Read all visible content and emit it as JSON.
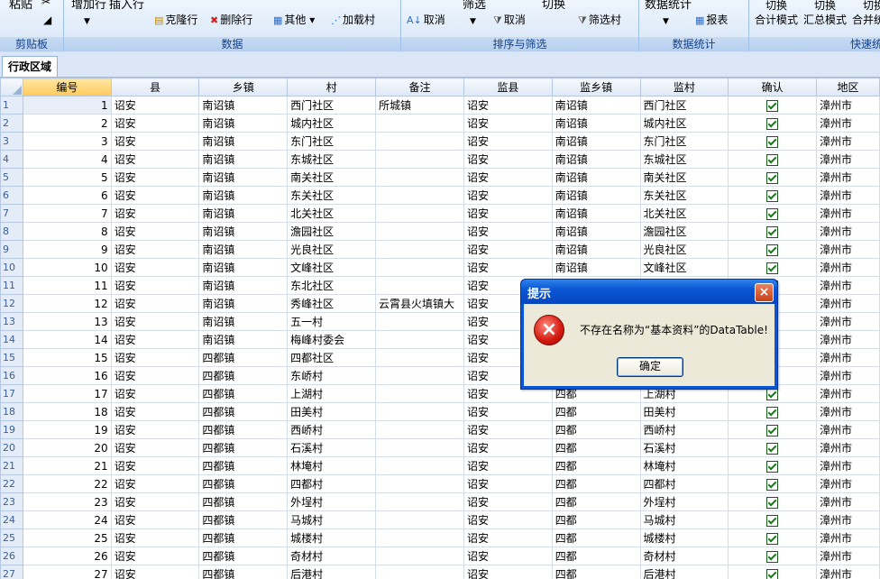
{
  "ribbon": {
    "groups": [
      {
        "title": "剪贴板",
        "buttons": [
          "粘贴"
        ]
      },
      {
        "title": "数据",
        "buttons": [
          "增加行",
          "插入行",
          "克隆行",
          "删除行",
          "其他",
          "加载村"
        ]
      },
      {
        "title": "排序与筛选",
        "buttons": [
          "取消",
          "筛选",
          "取消",
          "切换",
          "筛选村"
        ]
      },
      {
        "title": "数据统计",
        "buttons": [
          "数据统计",
          "报表"
        ]
      },
      {
        "title": "快速统",
        "buttons": [
          "切换",
          "合计模式",
          "切换",
          "汇总模式",
          "切换",
          "合并统"
        ]
      }
    ]
  },
  "tab": {
    "label": "行政区域"
  },
  "grid": {
    "columns": [
      "编号",
      "县",
      "乡镇",
      "村",
      "备注",
      "监县",
      "监乡镇",
      "监村",
      "确认",
      "地区"
    ],
    "rows": [
      [
        "1",
        "1",
        "诏安",
        "南诏镇",
        "西门社区",
        "所城镇",
        "诏安",
        "南诏镇",
        "西门社区",
        "true",
        "漳州市"
      ],
      [
        "2",
        "2",
        "诏安",
        "南诏镇",
        "城内社区",
        "",
        "诏安",
        "南诏镇",
        "城内社区",
        "true",
        "漳州市"
      ],
      [
        "3",
        "3",
        "诏安",
        "南诏镇",
        "东门社区",
        "",
        "诏安",
        "南诏镇",
        "东门社区",
        "true",
        "漳州市"
      ],
      [
        "4",
        "4",
        "诏安",
        "南诏镇",
        "东城社区",
        "",
        "诏安",
        "南诏镇",
        "东城社区",
        "true",
        "漳州市"
      ],
      [
        "5",
        "5",
        "诏安",
        "南诏镇",
        "南关社区",
        "",
        "诏安",
        "南诏镇",
        "南关社区",
        "true",
        "漳州市"
      ],
      [
        "6",
        "6",
        "诏安",
        "南诏镇",
        "东关社区",
        "",
        "诏安",
        "南诏镇",
        "东关社区",
        "true",
        "漳州市"
      ],
      [
        "7",
        "7",
        "诏安",
        "南诏镇",
        "北关社区",
        "",
        "诏安",
        "南诏镇",
        "北关社区",
        "true",
        "漳州市"
      ],
      [
        "8",
        "8",
        "诏安",
        "南诏镇",
        "澹园社区",
        "",
        "诏安",
        "南诏镇",
        "澹园社区",
        "true",
        "漳州市"
      ],
      [
        "9",
        "9",
        "诏安",
        "南诏镇",
        "光良社区",
        "",
        "诏安",
        "南诏镇",
        "光良社区",
        "true",
        "漳州市"
      ],
      [
        "10",
        "10",
        "诏安",
        "南诏镇",
        "文峰社区",
        "",
        "诏安",
        "南诏镇",
        "文峰社区",
        "true",
        "漳州市"
      ],
      [
        "11",
        "11",
        "诏安",
        "南诏镇",
        "东北社区",
        "",
        "诏安",
        "",
        "",
        "true",
        "漳州市"
      ],
      [
        "12",
        "12",
        "诏安",
        "南诏镇",
        "秀峰社区",
        "云霄县火填镇大",
        "诏安",
        "",
        "",
        "true",
        "漳州市"
      ],
      [
        "13",
        "13",
        "诏安",
        "南诏镇",
        "五一村",
        "",
        "诏安",
        "",
        "",
        "true",
        "漳州市"
      ],
      [
        "14",
        "14",
        "诏安",
        "南诏镇",
        "梅峰村委会",
        "",
        "诏安",
        "",
        "",
        "true",
        "漳州市"
      ],
      [
        "15",
        "15",
        "诏安",
        "四都镇",
        "四都社区",
        "",
        "诏安",
        "",
        "",
        "true",
        "漳州市"
      ],
      [
        "16",
        "16",
        "诏安",
        "四都镇",
        "东峤村",
        "",
        "诏安",
        "",
        "",
        "true",
        "漳州市"
      ],
      [
        "17",
        "17",
        "诏安",
        "四都镇",
        "上湖村",
        "",
        "诏安",
        "四都",
        "上湖村",
        "true",
        "漳州市"
      ],
      [
        "18",
        "18",
        "诏安",
        "四都镇",
        "田美村",
        "",
        "诏安",
        "四都",
        "田美村",
        "true",
        "漳州市"
      ],
      [
        "19",
        "19",
        "诏安",
        "四都镇",
        "西峤村",
        "",
        "诏安",
        "四都",
        "西峤村",
        "true",
        "漳州市"
      ],
      [
        "20",
        "20",
        "诏安",
        "四都镇",
        "石溪村",
        "",
        "诏安",
        "四都",
        "石溪村",
        "true",
        "漳州市"
      ],
      [
        "21",
        "21",
        "诏安",
        "四都镇",
        "林埯村",
        "",
        "诏安",
        "四都",
        "林埯村",
        "true",
        "漳州市"
      ],
      [
        "22",
        "22",
        "诏安",
        "四都镇",
        "四都村",
        "",
        "诏安",
        "四都",
        "四都村",
        "true",
        "漳州市"
      ],
      [
        "23",
        "23",
        "诏安",
        "四都镇",
        "外埕村",
        "",
        "诏安",
        "四都",
        "外埕村",
        "true",
        "漳州市"
      ],
      [
        "24",
        "24",
        "诏安",
        "四都镇",
        "马城村",
        "",
        "诏安",
        "四都",
        "马城村",
        "true",
        "漳州市"
      ],
      [
        "25",
        "25",
        "诏安",
        "四都镇",
        "城楼村",
        "",
        "诏安",
        "四都",
        "城楼村",
        "true",
        "漳州市"
      ],
      [
        "26",
        "26",
        "诏安",
        "四都镇",
        "奇材村",
        "",
        "诏安",
        "四都",
        "奇材村",
        "true",
        "漳州市"
      ],
      [
        "27",
        "27",
        "诏安",
        "四都镇",
        "后港村",
        "",
        "诏安",
        "四都",
        "后港村",
        "true",
        "漳州市"
      ]
    ]
  },
  "dialog": {
    "title": "提示",
    "message": "不存在名称为“基本资料”的DataTable!",
    "ok_label": "确定",
    "close_glyph": "×",
    "icon_glyph": "×"
  },
  "colors": {
    "ribbon_bg": "#cfe0f5",
    "dialog_title": "#0a55d3",
    "error_red": "#d3180f",
    "selected_header": "#ffc95d"
  }
}
